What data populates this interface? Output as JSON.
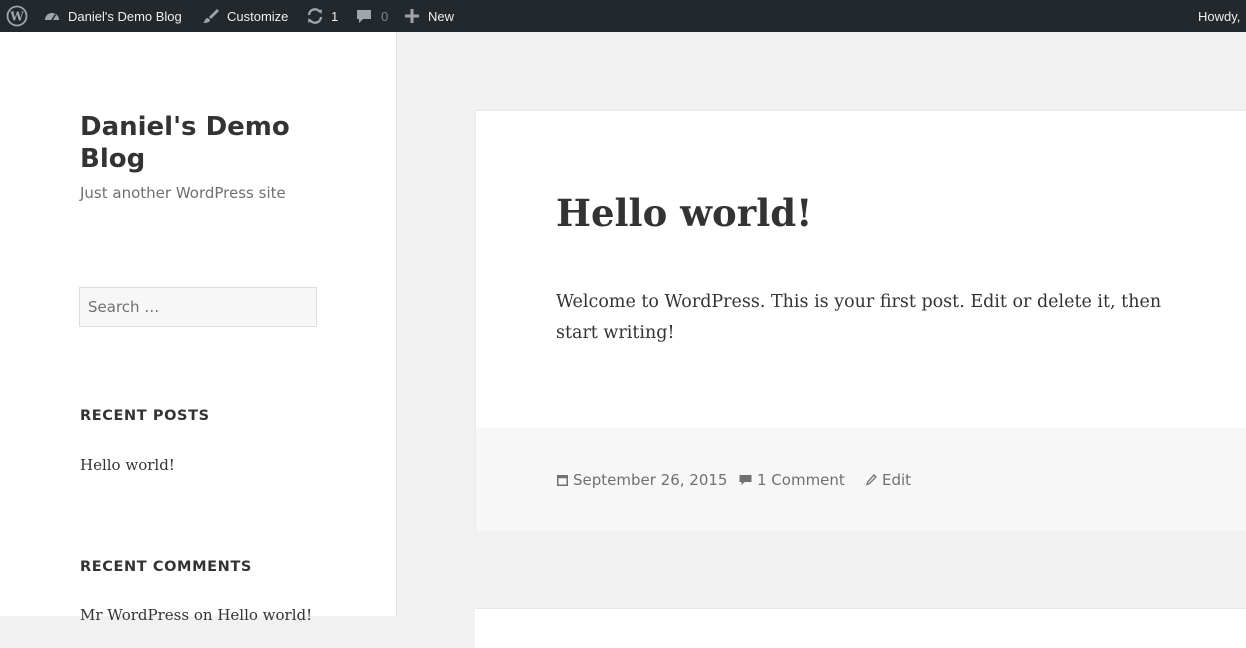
{
  "adminbar": {
    "site_name": "Daniel's Demo Blog",
    "customize": "Customize",
    "updates_count": "1",
    "comments_count": "0",
    "new_label": "New",
    "howdy": "Howdy,"
  },
  "sidebar": {
    "site_title": "Daniel's Demo Blog",
    "site_description": "Just another WordPress site",
    "search_placeholder": "Search …",
    "recent_posts_title": "RECENT POSTS",
    "recent_posts": [
      "Hello world!"
    ],
    "recent_comments_title": "RECENT COMMENTS",
    "recent_comment": {
      "author": "Mr WordPress",
      "on": "on",
      "post": "Hello world!"
    }
  },
  "post": {
    "title": "Hello world!",
    "body": "Welcome to WordPress. This is your first post. Edit or delete it, then start writing!",
    "date": "September 26, 2015",
    "comments": "1 Comment",
    "edit": "Edit"
  },
  "icons": {
    "wordpress_logo": "wordpress-icon",
    "dashboard": "dashboard-icon",
    "customize": "brush-icon",
    "updates": "refresh-icon",
    "comments": "comment-bubble-icon",
    "new": "plus-icon",
    "date": "calendar-icon",
    "comment_meta": "comment-icon",
    "edit": "pencil-icon"
  }
}
